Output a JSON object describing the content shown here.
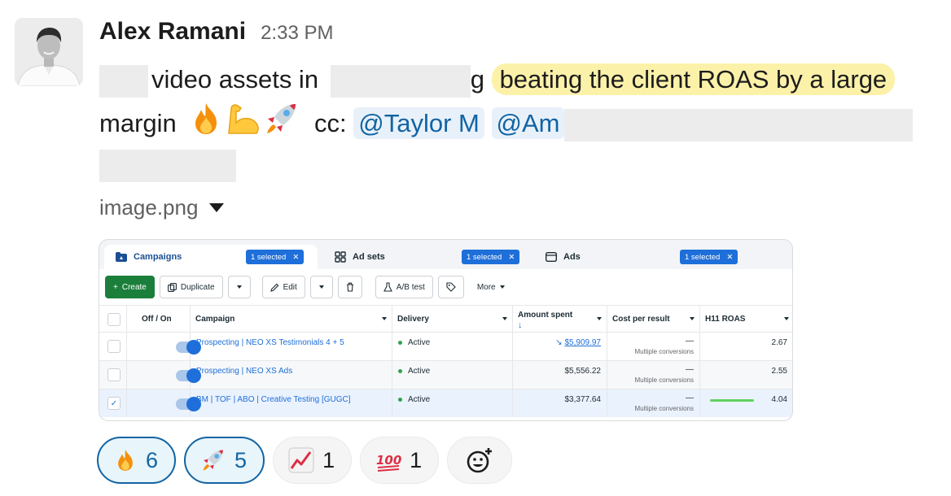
{
  "message": {
    "author": "Alex Ramani",
    "time": "2:33 PM",
    "line1_text": "video assets in",
    "line1_fragment": "g",
    "highlight": "beating the client ROAS by a large",
    "line2_text": "margin",
    "cc_label": "cc:",
    "mentions": [
      "@Taylor M",
      "@Am"
    ],
    "attachment_name": "image.png"
  },
  "screenshot": {
    "tabs": [
      {
        "label": "Campaigns",
        "badge": "1 selected",
        "icon": "folder-icon"
      },
      {
        "label": "Ad sets",
        "badge": "1 selected",
        "icon": "grid-icon"
      },
      {
        "label": "Ads",
        "badge": "1 selected",
        "icon": "ad-icon"
      }
    ],
    "toolbar": {
      "create": "Create",
      "duplicate": "Duplicate",
      "edit": "Edit",
      "abtest": "A/B test",
      "more": "More"
    },
    "columns": {
      "offon": "Off / On",
      "campaign": "Campaign",
      "delivery": "Delivery",
      "amount": "Amount spent",
      "cpr": "Cost per result",
      "roas": "H11 ROAS"
    },
    "rows": [
      {
        "campaign": "Prospecting | NEO XS Testimonials 4 + 5",
        "delivery": "Active",
        "amount": "$5,909.97",
        "cpr": "—",
        "cpr_sub": "Multiple conversions",
        "roas": "2.67",
        "checked": false,
        "on": true
      },
      {
        "campaign": "Prospecting | NEO XS Ads",
        "delivery": "Active",
        "amount": "$5,556.22",
        "cpr": "—",
        "cpr_sub": "Multiple conversions",
        "roas": "2.55",
        "checked": false,
        "on": true
      },
      {
        "campaign": "BM | TOF | ABO | Creative Testing [GUGC]",
        "delivery": "Active",
        "amount": "$3,377.64",
        "cpr": "—",
        "cpr_sub": "Multiple conversions",
        "roas": "4.04",
        "checked": true,
        "on": true
      }
    ]
  },
  "reactions": [
    {
      "emoji": "fire",
      "count": "6",
      "mine": true
    },
    {
      "emoji": "rocket",
      "count": "5",
      "mine": true
    },
    {
      "emoji": "chart-increasing",
      "count": "1",
      "mine": false
    },
    {
      "emoji": "hundred-points",
      "count": "1",
      "mine": false
    }
  ],
  "colors": {
    "highlight": "#fbf1a9",
    "mention_bg": "#e8f1fa",
    "mention_text": "#1264a3",
    "fb_blue": "#1e6fd9",
    "create_green": "#1b7f3b",
    "active_dot": "#31a24c"
  }
}
